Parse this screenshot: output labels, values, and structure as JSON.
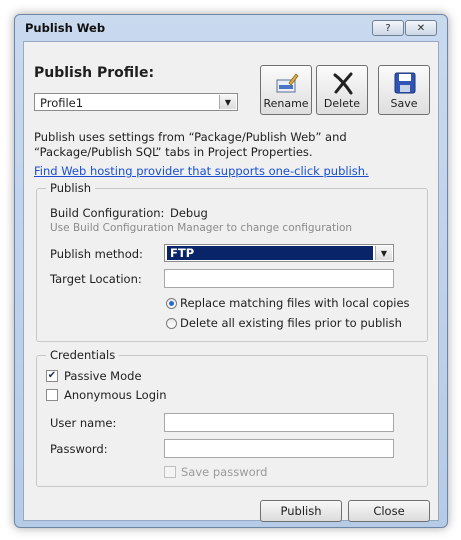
{
  "window": {
    "title": "Publish Web",
    "help_glyph": "?",
    "close_glyph": "✕"
  },
  "profile": {
    "heading": "Publish Profile:",
    "selected": "Profile1",
    "buttons": {
      "rename": "Rename",
      "delete": "Delete",
      "save": "Save"
    }
  },
  "description": "Publish uses settings from “Package/Publish Web” and “Package/Publish SQL” tabs in Project Properties.",
  "hosting_link": "Find Web hosting provider that supports one-click publish.",
  "publish": {
    "legend": "Publish",
    "build_config_label": "Build Configuration:",
    "build_config_value": "Debug",
    "build_config_hint": "Use Build Configuration Manager to change configuration",
    "method_label": "Publish method:",
    "method_value": "FTP",
    "target_label": "Target Location:",
    "target_value": "",
    "radio_replace": "Replace matching files with local copies",
    "radio_delete": "Delete all existing files prior to publish",
    "radio_selected": "replace"
  },
  "credentials": {
    "legend": "Credentials",
    "passive_label": "Passive Mode",
    "passive_checked": true,
    "anon_label": "Anonymous Login",
    "anon_checked": false,
    "username_label": "User name:",
    "username_value": "",
    "password_label": "Password:",
    "password_value": "",
    "save_password_label": "Save password",
    "save_password_checked": false
  },
  "footer": {
    "publish": "Publish",
    "close": "Close"
  },
  "colors": {
    "link": "#1a4fd0",
    "selection": "#0a246a",
    "accent_radio": "#2a6bd1"
  }
}
